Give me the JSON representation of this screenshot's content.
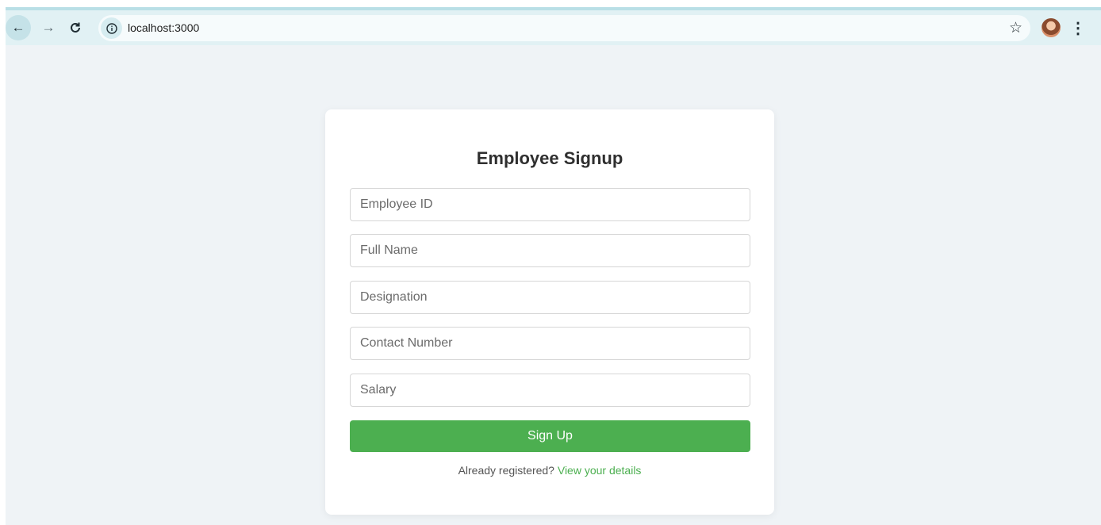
{
  "browser": {
    "url": "localhost:3000",
    "back_icon": "arrow-left",
    "forward_icon": "arrow-right",
    "reload_icon": "reload",
    "info_icon": "info",
    "bookmark_icon": "star",
    "menu_icon": "vertical-dots"
  },
  "form": {
    "title": "Employee Signup",
    "fields": [
      {
        "placeholder": "Employee ID",
        "value": ""
      },
      {
        "placeholder": "Full Name",
        "value": ""
      },
      {
        "placeholder": "Designation",
        "value": ""
      },
      {
        "placeholder": "Contact Number",
        "value": ""
      },
      {
        "placeholder": "Salary",
        "value": ""
      }
    ],
    "submit_label": "Sign Up",
    "footer_text": "Already registered?",
    "footer_link": "View your details"
  },
  "colors": {
    "accent": "#4caf50",
    "page_bg": "#eff3f6",
    "toolbar_bg": "#e1f1f4"
  }
}
